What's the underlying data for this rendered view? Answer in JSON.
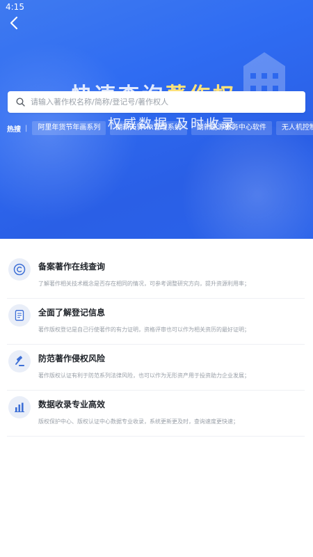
{
  "status_bar": {
    "time": "4:15"
  },
  "header": {
    "back_icon": "chevron-left-icon",
    "title_prefix": "快速查询",
    "title_highlight": "著作权",
    "subtitle": "权威数据 及时收录"
  },
  "search": {
    "placeholder": "请输入著作权名称/简称/登记号/著作权人",
    "icon": "search-icon"
  },
  "hot": {
    "label": "热搜",
    "separator": "|",
    "tags": [
      "阿里年货节年画系列",
      "朗新天霁HR管理系统",
      "朗新能源服务中心软件",
      "无人机控制器校准系统"
    ]
  },
  "features": [
    {
      "icon": "copyright-icon",
      "title": "备案著作在线查询",
      "desc": "了解著作相关技术概念是否存在相同的情况，可参考调整研究方向，提升资源利用率；"
    },
    {
      "icon": "document-icon",
      "title": "全面了解登记信息",
      "desc": "著作版权登记是自己行使著作的有力证明，资格评审也可以作为相关资历的最好证明；"
    },
    {
      "icon": "gavel-icon",
      "title": "防范著作侵权风险",
      "desc": "著作版权认证有利于防范系列法律风险，也可以作为无形资产用于投资助力企业发展；"
    },
    {
      "icon": "bar-chart-icon",
      "title": "数据收录专业高效",
      "desc": "版权保护中心、版权认证中心数据专业收录，系统更新更及时，查询速度更快速；"
    }
  ],
  "colors": {
    "hero_blue": "#2f6cf2",
    "accent_yellow": "#ffe27a",
    "icon_blue": "#3d6fd6"
  }
}
